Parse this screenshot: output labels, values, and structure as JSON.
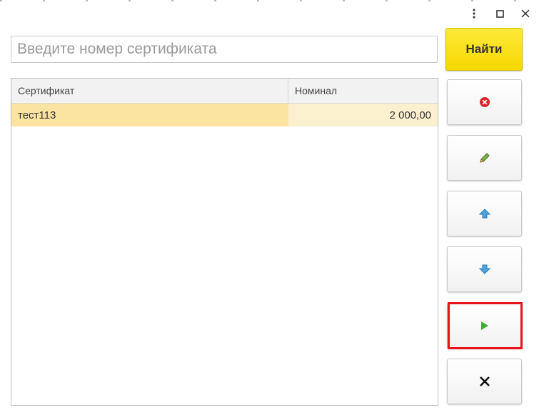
{
  "window": {
    "controls": [
      {
        "name": "more-icon"
      },
      {
        "name": "maximize-icon"
      },
      {
        "name": "close-icon"
      }
    ]
  },
  "search": {
    "placeholder": "Введите номер сертификата",
    "value": ""
  },
  "find_button": {
    "label": "Найти",
    "color": "#f5d800"
  },
  "table": {
    "columns": [
      "Сертификат",
      "Номинал"
    ],
    "rows": [
      {
        "certificate": "тест113",
        "nominal": "2 000,00",
        "selected": true
      }
    ]
  },
  "actions": [
    {
      "name": "delete-button",
      "icon": "red-x-circle-icon"
    },
    {
      "name": "edit-button",
      "icon": "pencil-icon"
    },
    {
      "name": "move-up-button",
      "icon": "arrow-up-icon"
    },
    {
      "name": "move-down-button",
      "icon": "arrow-down-icon"
    },
    {
      "name": "run-button",
      "icon": "play-icon",
      "highlighted": true
    },
    {
      "name": "cancel-button",
      "icon": "close-icon"
    }
  ],
  "colors": {
    "selected_row": "#fbe3a2",
    "highlight_frame": "#e8141a"
  }
}
